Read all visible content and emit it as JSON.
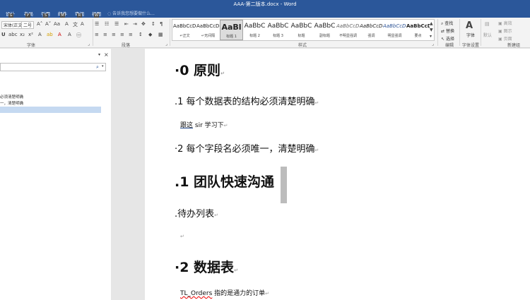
{
  "window": {
    "title": "AAA-第二版本.docx - Word"
  },
  "tabs": [
    {
      "label": "设计",
      "keytip": "G"
    },
    {
      "label": "布局",
      "keytip": "P"
    },
    {
      "label": "引用",
      "keytip": "S"
    },
    {
      "label": "邮件",
      "keytip": "M"
    },
    {
      "label": "审阅",
      "keytip": "R"
    },
    {
      "label": "视图",
      "keytip": "W"
    }
  ],
  "tell_me": "告诉我您想要做什么...",
  "ribbon": {
    "font_name": "宋体(正文)",
    "font_size": "二号",
    "groups": {
      "font": "字体",
      "paragraph": "段落",
      "styles": "样式",
      "editing": "编辑",
      "font_settings": "字体设置",
      "new_group": "新建组"
    },
    "styles": [
      {
        "sample": "AaBbCcDd",
        "name": "↵正文"
      },
      {
        "sample": "AaBbCcDd",
        "name": "↵无间隔"
      },
      {
        "sample": "AaBl",
        "name": "标题 1"
      },
      {
        "sample": "AaBbC",
        "name": "标题 2"
      },
      {
        "sample": "AaBbC",
        "name": "标题 3"
      },
      {
        "sample": "AaBbC",
        "name": "标题"
      },
      {
        "sample": "AaBbC",
        "name": "副标题"
      },
      {
        "sample": "AaBbCcDd",
        "name": "不明显强调"
      },
      {
        "sample": "AaBbCcDd",
        "name": "强调"
      },
      {
        "sample": "AaBbCcDd",
        "name": "明显强调"
      },
      {
        "sample": "AaBbCcDd",
        "name": "要点"
      }
    ],
    "editing": {
      "find": "查找",
      "replace": "替换",
      "select": "选择"
    },
    "font_button": "字体",
    "right": {
      "default": "默认",
      "item1": "高效",
      "item2": "图示",
      "item3": "页面"
    }
  },
  "nav_pane": {
    "items": [
      "必须清楚明确",
      "一，清楚明确"
    ]
  },
  "document": {
    "p1": "·0  原则",
    "p2": ".1  每个数据表的结构必须清楚明确",
    "p3_a": "跟这",
    "p3_b": " sir 学习下",
    "p4": "·2  每个字段名必须唯一，清楚明确",
    "p5": ".1  团队快速沟通",
    "p6": ".待办列表",
    "p7": "·2  数据表",
    "p8_a": "TL_Orders",
    "p8_b": "  指的是通力的订单"
  }
}
